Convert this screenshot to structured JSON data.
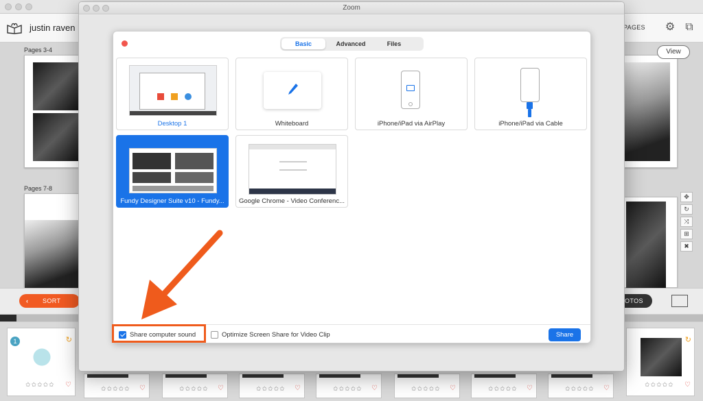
{
  "app": {
    "username": "justin raven",
    "pages_label": "PAGES",
    "view_label": "View",
    "spread_1_label": "Pages 3-4",
    "spread_2_label": "Pages 7-8",
    "sort_label": "SORT",
    "photos_label": "OTOS",
    "progress": 0.023,
    "film_badge": "1",
    "stars": "✩✩✩✩✩",
    "heart": "♡",
    "swirl": "↻"
  },
  "zoom": {
    "window_title": "Zoom",
    "tabs": [
      {
        "label": "Basic",
        "active": true
      },
      {
        "label": "Advanced",
        "active": false
      },
      {
        "label": "Files",
        "active": false
      }
    ],
    "tiles": [
      {
        "label": "Desktop 1"
      },
      {
        "label": "Whiteboard"
      },
      {
        "label": "iPhone/iPad via AirPlay"
      },
      {
        "label": "iPhone/iPad via Cable"
      },
      {
        "label": "Fundy Designer Suite v10 - Fundy..."
      },
      {
        "label": "Google Chrome - Video Conferenc..."
      }
    ],
    "share_sound_label": "Share computer sound",
    "share_sound_checked": true,
    "optimize_label": "Optimize Screen Share for Video Clip",
    "optimize_checked": false,
    "share_button": "Share"
  },
  "colors": {
    "accent": "#1a73e8",
    "annotation": "#ef5b1c",
    "sort": "#f15a22"
  }
}
